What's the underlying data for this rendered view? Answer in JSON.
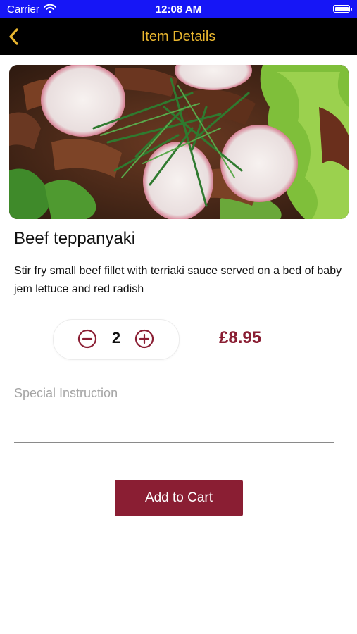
{
  "status_bar": {
    "carrier": "Carrier",
    "time": "12:08 AM"
  },
  "nav": {
    "title": "Item Details",
    "back_icon": "chevron-left-icon"
  },
  "item": {
    "name": "Beef teppanyaki",
    "description": "Stir fry small beef fillet with terriaki sauce served on a bed of baby jem lettuce and red radish",
    "quantity": "2",
    "price": "£8.95"
  },
  "special_instruction": {
    "placeholder": "Special Instruction",
    "value": ""
  },
  "actions": {
    "add_to_cart_label": "Add to Cart"
  },
  "colors": {
    "accent": "#8a1e33",
    "nav_title": "#e9b62f",
    "status_bar": "#1616f6",
    "nav_bg": "#000000"
  }
}
